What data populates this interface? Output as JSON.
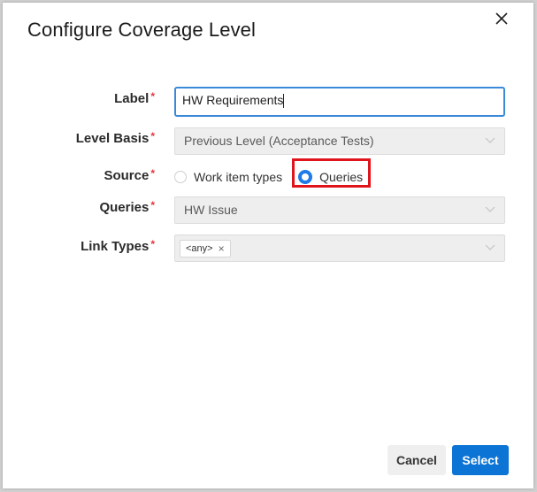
{
  "dialog": {
    "title": "Configure Coverage Level",
    "close_icon": "close-icon"
  },
  "form": {
    "label": {
      "label": "Label",
      "required_mark": "*",
      "value": "HW Requirements"
    },
    "level_basis": {
      "label": "Level Basis",
      "required_mark": "*",
      "value": "Previous Level (Acceptance Tests)",
      "icon": "chevron-down-icon"
    },
    "source": {
      "label": "Source",
      "required_mark": "*",
      "options": [
        {
          "label": "Work item types",
          "selected": false
        },
        {
          "label": "Queries",
          "selected": true
        }
      ]
    },
    "queries": {
      "label": "Queries",
      "required_mark": "*",
      "value": "HW Issue",
      "icon": "chevron-down-icon"
    },
    "link_types": {
      "label": "Link Types",
      "required_mark": "*",
      "tags": [
        {
          "label": "<any>",
          "remove_icon": "close-icon"
        }
      ],
      "icon": "chevron-down-icon"
    }
  },
  "footer": {
    "cancel_label": "Cancel",
    "select_label": "Select"
  },
  "colors": {
    "accent": "#0b74d4",
    "required": "#e8353a",
    "highlight": "#e0141b"
  }
}
